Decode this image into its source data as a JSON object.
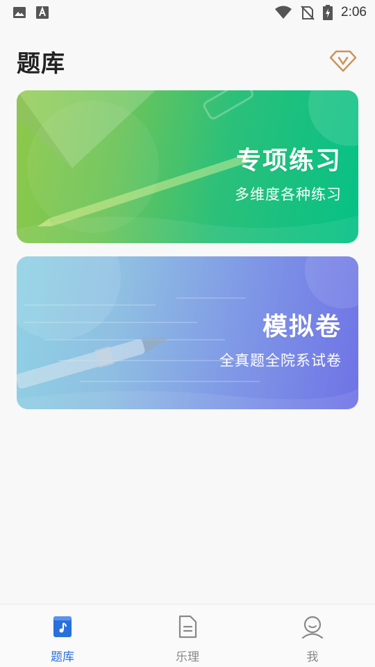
{
  "status_bar": {
    "time": "2:06",
    "icons": [
      "image-icon",
      "font-a-icon",
      "wifi-icon",
      "no-sim-icon",
      "battery-charging-icon"
    ]
  },
  "header": {
    "title": "题库",
    "vip_icon": "diamond-v-icon"
  },
  "cards": [
    {
      "title": "专项练习",
      "subtitle": "多维度各种练习"
    },
    {
      "title": "模拟卷",
      "subtitle": "全真题全院系试卷"
    }
  ],
  "bottom_nav": {
    "items": [
      {
        "label": "题库",
        "icon": "music-book-icon",
        "active": true
      },
      {
        "label": "乐理",
        "icon": "document-icon",
        "active": false
      },
      {
        "label": "我",
        "icon": "user-icon",
        "active": false
      }
    ]
  },
  "colors": {
    "accent": "#2a6fdb",
    "vip_gold": "#c9955a",
    "card1_start": "#8fc94a",
    "card1_end": "#06c186",
    "card2_start": "#8fd2e4",
    "card2_end": "#6f73e6"
  }
}
